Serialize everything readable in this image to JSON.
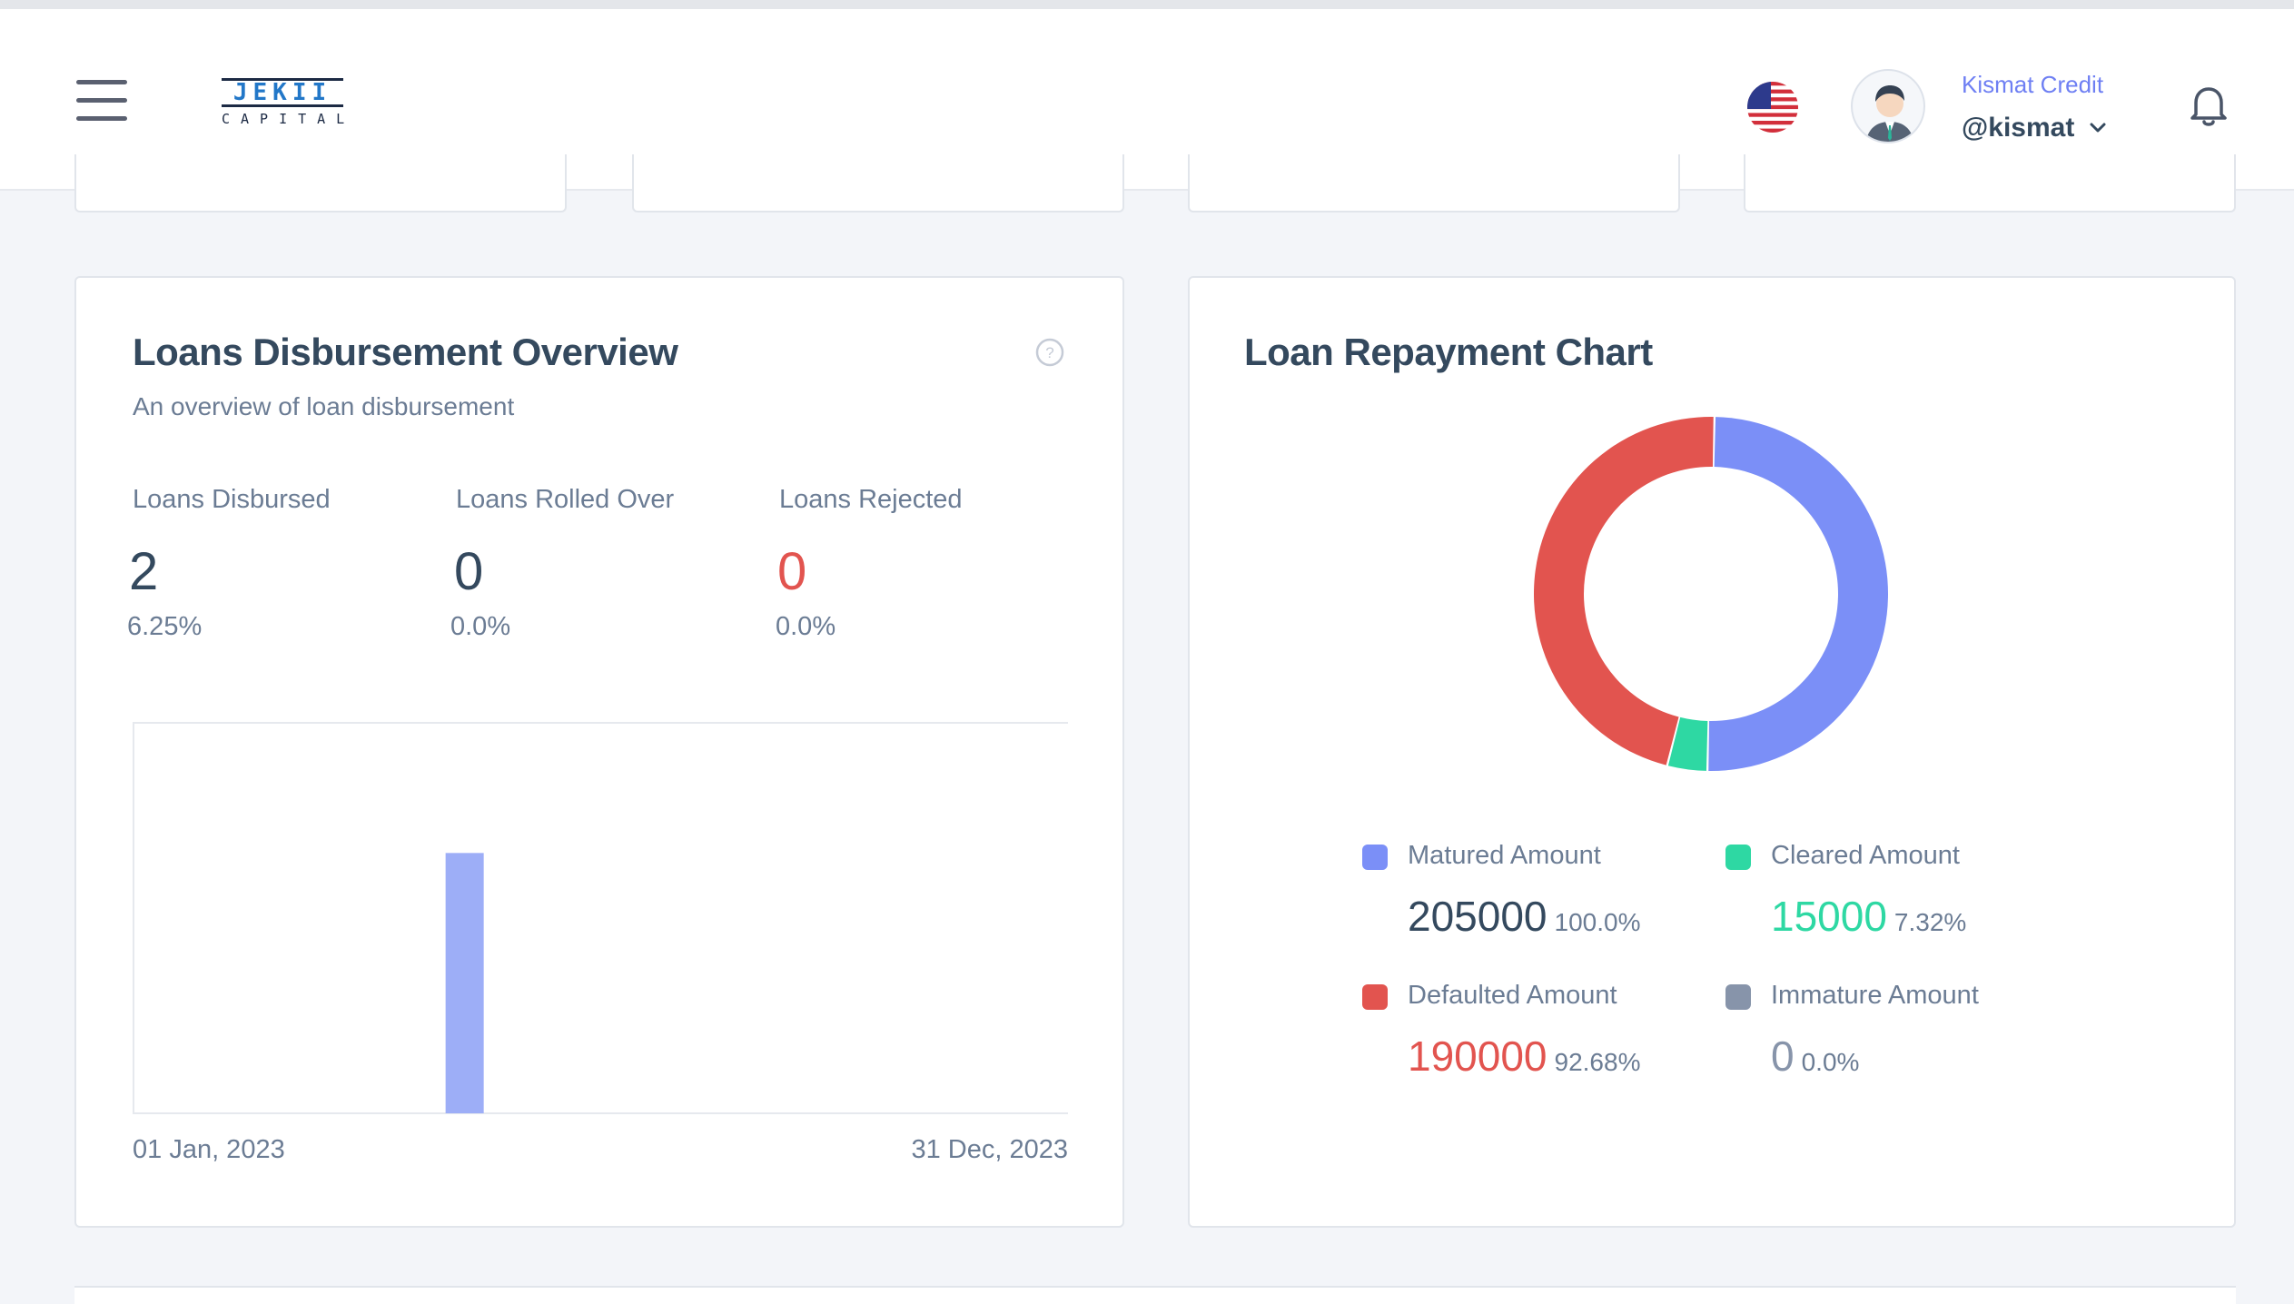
{
  "header": {
    "brand_name": "Kismat Credit",
    "username": "@kismat",
    "logo": {
      "top": "JEKII",
      "bottom": "CAPITAL"
    }
  },
  "disbursement": {
    "title": "Loans Disbursement Overview",
    "subtitle": "An overview of loan disbursement",
    "stats": [
      {
        "label": "Loans Disbursed",
        "value": "2",
        "pct": "6.25%"
      },
      {
        "label": "Loans Rolled Over",
        "value": "0",
        "pct": "0.0%"
      },
      {
        "label": "Loans Rejected",
        "value": "0",
        "pct": "0.0%"
      }
    ],
    "date_start": "01 Jan, 2023",
    "date_end": "31 Dec, 2023"
  },
  "repayment": {
    "title": "Loan Repayment Chart",
    "legend": [
      {
        "label": "Matured Amount",
        "value": "205000",
        "pct": "100.0%",
        "color": "#7b8ff7"
      },
      {
        "label": "Cleared Amount",
        "value": "15000",
        "pct": "7.32%",
        "color": "#2ed8a3"
      },
      {
        "label": "Defaulted Amount",
        "value": "190000",
        "pct": "92.68%",
        "color": "#e2544f"
      },
      {
        "label": "Immature Amount",
        "value": "0",
        "pct": "0.0%",
        "color": "#8794aa"
      }
    ]
  },
  "chart_data": [
    {
      "type": "bar",
      "x_start": "01 Jan, 2023",
      "x_end": "31 Dec, 2023",
      "bar_color": "#9daef7",
      "points": [
        {
          "position": 0.355,
          "value": 2
        }
      ],
      "ylim": [
        0,
        3
      ]
    },
    {
      "type": "pie",
      "donut": true,
      "slices": [
        {
          "label": "Matured Amount",
          "value": 205000,
          "color": "#7b8ff7"
        },
        {
          "label": "Cleared Amount",
          "value": 15000,
          "color": "#2ed8a3"
        },
        {
          "label": "Defaulted Amount",
          "value": 190000,
          "color": "#e2544f"
        },
        {
          "label": "Immature Amount",
          "value": 0,
          "color": "#8794aa"
        }
      ]
    }
  ]
}
